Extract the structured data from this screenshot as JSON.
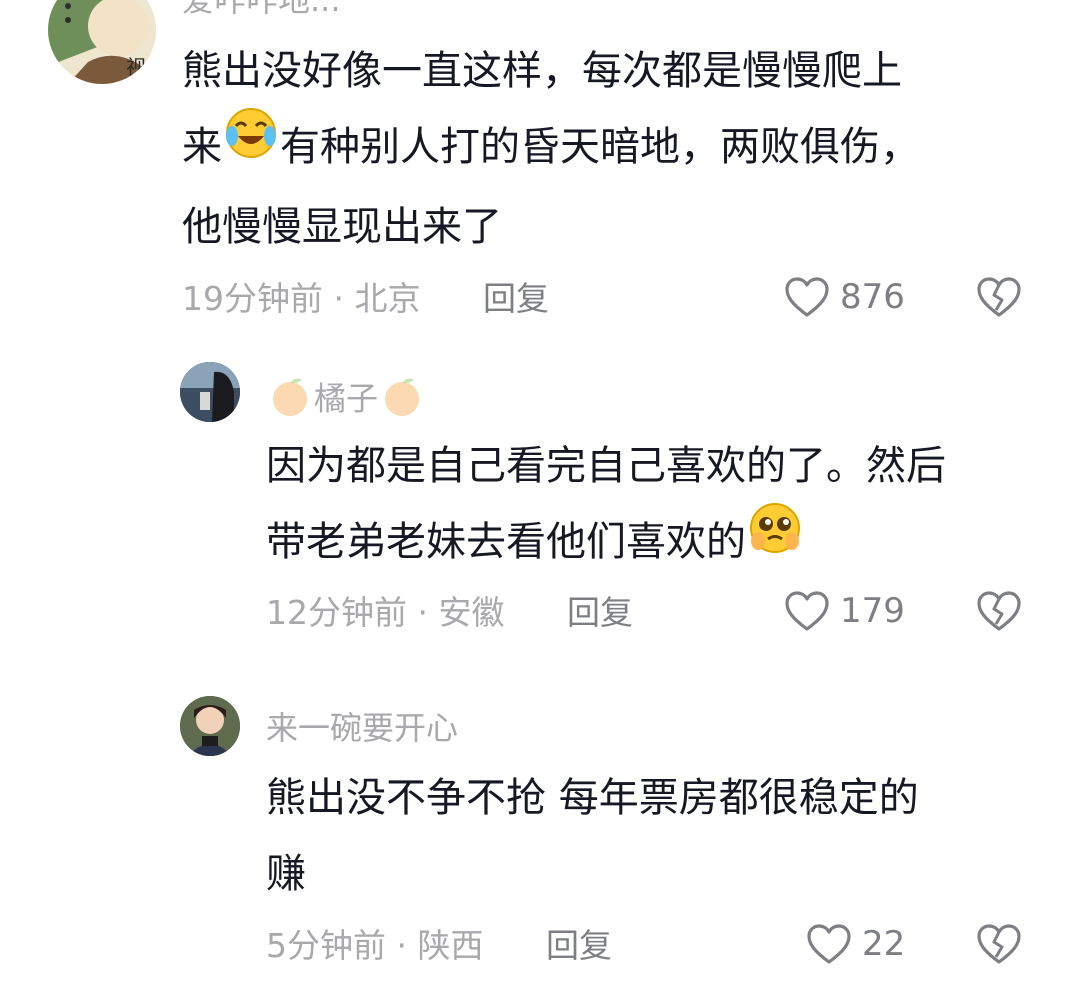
{
  "comments": [
    {
      "username": "爱咋咋地...",
      "lines": [
        "熊出没好像一直这样，每次都是慢慢爬上",
        "来",
        "有种别人打的昏天暗地，两败俱伤，",
        "他慢慢显现出来了"
      ],
      "time": "19分钟前",
      "separator": "·",
      "location": "北京",
      "reply_label": "回复",
      "likes": "876"
    },
    {
      "username": "橘子",
      "lines": [
        "因为都是自己看完自己喜欢的了。然后",
        "带老弟老妹去看他们喜欢的"
      ],
      "time": "12分钟前",
      "separator": "·",
      "location": "安徽",
      "reply_label": "回复",
      "likes": "179"
    },
    {
      "username": "来一碗要开心",
      "lines": [
        "熊出没不争不抢 每年票房都很稳定的",
        "赚"
      ],
      "time": "5分钟前",
      "separator": "·",
      "location": "陕西",
      "reply_label": "回复",
      "likes": "22"
    }
  ],
  "colors": {
    "text_primary": "#161823",
    "text_secondary": "#a8a8ad",
    "action": "#7d7f85"
  },
  "icons": {
    "like": "heart-outline-icon",
    "dislike": "broken-heart-icon",
    "laugh_cry": "laughing-crying-emoji",
    "pleading": "pleading-face-emoji",
    "orange": "tangerine-emoji"
  }
}
